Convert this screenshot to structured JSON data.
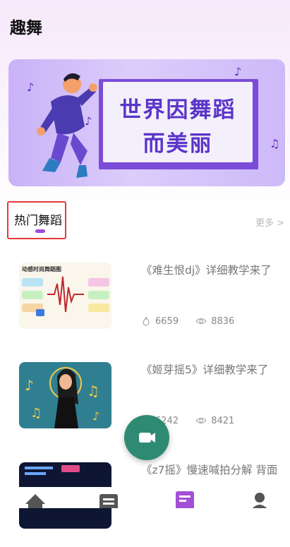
{
  "app": {
    "title": "趣舞"
  },
  "banner": {
    "slogan_line1": "世界因舞蹈",
    "slogan_line2": "而美丽",
    "colors": {
      "background": "#cdb9f8",
      "panel": "#7a4cd8",
      "text": "#5b34c9"
    }
  },
  "section": {
    "title": "热门舞蹈",
    "more_label": "更多 >"
  },
  "cards": [
    {
      "title": "《难生恨dj》详细教学来了",
      "likes": "6659",
      "views": "8836",
      "thumb_text": "动感时尚舞蹈图"
    },
    {
      "title": "《姬芽摇5》详细教学来了",
      "likes": "6242",
      "views": "8421"
    },
    {
      "title": "《z7摇》慢速喊拍分解 背面",
      "likes": "",
      "views": ""
    }
  ],
  "fab": {
    "icon": "video-camera-icon",
    "color": "#2f8a74"
  },
  "bottom_nav": [
    {
      "icon": "home-icon"
    },
    {
      "icon": "list-icon"
    },
    {
      "icon": "article-icon",
      "active": true,
      "color": "#a34fd6"
    },
    {
      "icon": "user-icon"
    }
  ]
}
